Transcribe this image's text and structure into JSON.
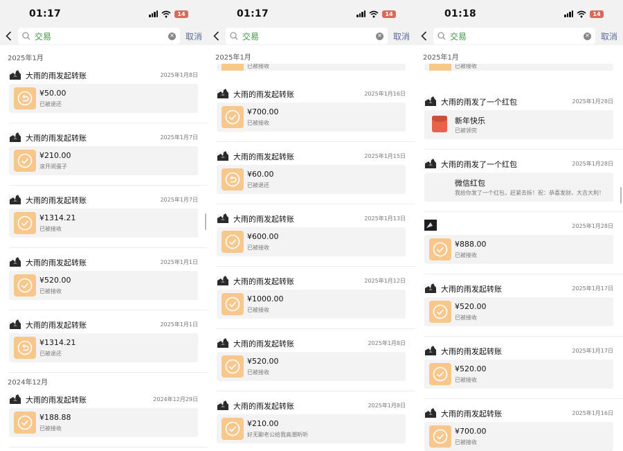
{
  "colors": {
    "accent_green": "#3f9a3f",
    "link_blue": "#576b95",
    "transfer_orange": "#f8c78c",
    "red_packet": "#e8634a"
  },
  "panels": [
    {
      "status": {
        "time": "01:17",
        "battery": "14"
      },
      "search": {
        "query": "交易",
        "cancel": "取消"
      },
      "sections": [
        {
          "month": "2025年1月",
          "items": [
            {
              "sender": "大雨的雨发起转账",
              "date": "2025年1月8日",
              "amount": "¥50.00",
              "status": "已被退还",
              "icon": "return-arrow-icon"
            },
            {
              "sender": "大雨的雨发起转账",
              "date": "2025年1月7日",
              "amount": "¥210.00",
              "status": "滚开闹蛋子",
              "icon": "check-icon"
            },
            {
              "sender": "大雨的雨发起转账",
              "date": "2025年1月7日",
              "amount": "¥1314.21",
              "status": "已被接收",
              "icon": "check-icon"
            },
            {
              "sender": "大雨的雨发起转账",
              "date": "2025年1月1日",
              "amount": "¥520.00",
              "status": "已被接收",
              "icon": "check-icon"
            },
            {
              "sender": "大雨的雨发起转账",
              "date": "2025年1月1日",
              "amount": "¥1314.21",
              "status": "已被退还",
              "icon": "return-arrow-icon"
            }
          ]
        },
        {
          "month": "2024年12月",
          "items": [
            {
              "sender": "大雨的雨发起转账",
              "date": "2024年12月29日",
              "amount": "¥188.88",
              "status": "已被接收",
              "icon": "check-icon"
            }
          ]
        }
      ]
    },
    {
      "status": {
        "time": "01:17",
        "battery": "14"
      },
      "search": {
        "query": "交易",
        "cancel": "取消"
      },
      "sticky_month": "2025年1月",
      "partial_status": "已被接收",
      "items": [
        {
          "sender": "大雨的雨发起转账",
          "date": "2025年1月16日",
          "amount": "¥700.00",
          "status": "已被接收",
          "icon": "check-icon"
        },
        {
          "sender": "大雨的雨发起转账",
          "date": "2025年1月15日",
          "amount": "¥60.00",
          "status": "已被退还",
          "icon": "return-arrow-icon"
        },
        {
          "sender": "大雨的雨发起转账",
          "date": "2025年1月13日",
          "amount": "¥600.00",
          "status": "已被接收",
          "icon": "check-icon"
        },
        {
          "sender": "大雨的雨发起转账",
          "date": "2025年1月12日",
          "amount": "¥1000.00",
          "status": "已被接收",
          "icon": "check-icon"
        },
        {
          "sender": "大雨的雨发起转账",
          "date": "2025年1月8日",
          "amount": "¥520.00",
          "status": "已被接收",
          "icon": "check-icon"
        },
        {
          "sender": "大雨的雨发起转账",
          "date": "2025年1月8日",
          "amount": "¥210.00",
          "status": "好无聊老公给我高潮听听",
          "icon": "check-icon"
        }
      ]
    },
    {
      "status": {
        "time": "01:18",
        "battery": "14"
      },
      "search": {
        "query": "交易",
        "cancel": "取消"
      },
      "sticky_month": "2025年1月",
      "partial_status": "已被接收",
      "items": [
        {
          "kind": "redpacket",
          "sender": "大雨的雨发了一个红包",
          "date": "2025年1月28日",
          "title": "新年快乐",
          "status": "已被领完"
        },
        {
          "kind": "redpacket_plain",
          "sender": "大雨的雨发了一个红包",
          "date": "2025年1月28日",
          "title": "微信红包",
          "status": "我给你发了一个红包，赶紧去拆！祝：恭喜发财，大吉大利！"
        },
        {
          "kind": "transfer_noname",
          "date": "2025年1月28日",
          "amount": "¥888.00",
          "status": "已被接收",
          "icon": "check-icon"
        },
        {
          "sender": "大雨的雨发起转账",
          "date": "2025年1月17日",
          "amount": "¥520.00",
          "status": "已被接收",
          "icon": "check-icon"
        },
        {
          "sender": "大雨的雨发起转账",
          "date": "2025年1月17日",
          "amount": "¥520.00",
          "status": "已被接收",
          "icon": "check-icon"
        },
        {
          "sender": "大雨的雨发起转账",
          "date": "2025年1月16日",
          "amount": "¥700.00",
          "status": "已被接收",
          "icon": "check-icon"
        }
      ]
    }
  ]
}
